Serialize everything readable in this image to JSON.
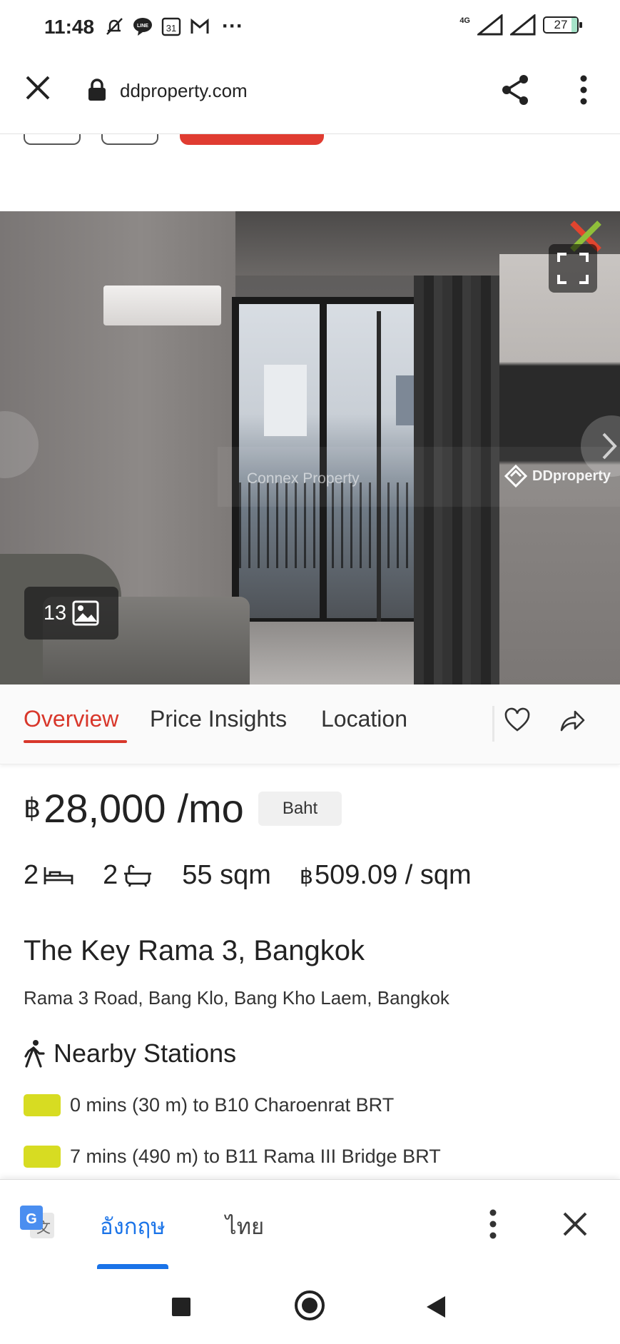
{
  "status_bar": {
    "time": "11:48",
    "network": "4G",
    "battery": "27",
    "icons": [
      "mute-icon",
      "line-icon",
      "calendar-icon",
      "gmail-icon",
      "more-icon",
      "signal-icon",
      "battery-icon"
    ],
    "calendar_day": "31",
    "more": "···"
  },
  "browser": {
    "url": "ddproperty.com",
    "icons": [
      "close-icon",
      "lock-icon",
      "share-icon",
      "menu-icon"
    ]
  },
  "gallery": {
    "photo_count": "13",
    "watermark_left": "Connex Property",
    "watermark_right": "DDproperty",
    "icons": [
      "fullscreen-icon",
      "image-icon",
      "chevron-right-icon"
    ]
  },
  "tabs": [
    {
      "label": "Overview",
      "active": true
    },
    {
      "label": "Price Insights",
      "active": false
    },
    {
      "label": "Location",
      "active": false
    }
  ],
  "listing": {
    "currency_symbol": "฿",
    "price": "28,000",
    "price_unit": "/mo",
    "currency_badge": "Baht",
    "bedrooms": "2",
    "bathrooms": "2",
    "area": "55 sqm",
    "price_per_sqm_symbol": "฿",
    "price_per_sqm": "509.09 / sqm",
    "title": "The Key Rama 3, Bangkok",
    "address": "Rama 3 Road, Bang Klo, Bang Kho Laem, Bangkok"
  },
  "nearby": {
    "heading": "Nearby Stations",
    "stations": [
      {
        "text": "0 mins (30 m) to B10 Charoenrat BRT",
        "color": "#d7dc22"
      },
      {
        "text": "7 mins (490 m) to B11 Rama III Bridge BRT",
        "color": "#d7dc22"
      }
    ]
  },
  "translate": {
    "source_lang": "อังกฤษ",
    "target_lang": "ไทย"
  },
  "colors": {
    "accent": "#d8372b",
    "translate_blue": "#1a73e8"
  }
}
